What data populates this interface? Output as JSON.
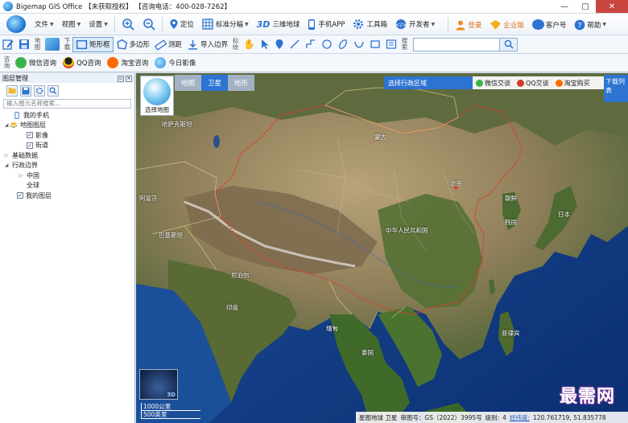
{
  "window": {
    "title": "Bigemap GIS Office 【未获取授权】 【咨询电话：400-028-7262】",
    "controls": [
      "—",
      "□",
      "✕"
    ]
  },
  "menubar": {
    "items": [
      {
        "label": "文件",
        "has_caret": true
      },
      {
        "label": "视图",
        "has_caret": true
      },
      {
        "label": "设置",
        "has_caret": true
      }
    ],
    "tools": [
      {
        "label": "定位",
        "icon": "location-icon"
      },
      {
        "label": "标准分幅",
        "icon": "grid-icon",
        "has_caret": true
      },
      {
        "label": "三维地球",
        "icon": "3d-icon",
        "prefix": "3D"
      },
      {
        "label": "手机APP",
        "icon": "phone-icon"
      },
      {
        "label": "工具箱",
        "icon": "gear-icon"
      },
      {
        "label": "开发者",
        "icon": "developer-icon",
        "has_caret": true
      }
    ],
    "right": [
      {
        "label": "登录",
        "icon": "user-icon"
      },
      {
        "label": "企业版",
        "icon": "enterprise-icon"
      },
      {
        "label": "客户号",
        "icon": "customer-icon"
      },
      {
        "label": "帮助",
        "icon": "help-icon",
        "has_caret": true
      }
    ]
  },
  "toolbar": {
    "group_map": "地图",
    "group_download": "下载",
    "rect_label": "矩形框",
    "polygon_label": "多边形",
    "measure_label": "测距",
    "import_label": "导入边界",
    "group_mark": "标绘",
    "group_search": "搜索",
    "search_placeholder": ""
  },
  "consultbar": {
    "group_label": "咨询",
    "items": [
      {
        "label": "微信咨询",
        "icon": "wechat-icon",
        "color": "#3bb34a"
      },
      {
        "label": "QQ咨询",
        "icon": "qq-icon",
        "color": "#222222"
      },
      {
        "label": "淘宝咨询",
        "icon": "taobao-icon",
        "color": "#ff6a00"
      },
      {
        "label": "今日影像",
        "icon": "globe-icon",
        "color": "#2d8ae0"
      }
    ]
  },
  "layer_panel": {
    "title": "图层管理",
    "search_placeholder": "输入图元名称搜索...",
    "tree": [
      {
        "label": "我的手机",
        "level": 1,
        "kind": "phone"
      },
      {
        "label": "地图图层",
        "level": 0,
        "kind": "folder",
        "expanded": true
      },
      {
        "label": "影像",
        "level": 2,
        "kind": "check",
        "checked": true
      },
      {
        "label": "街道",
        "level": 2,
        "kind": "check",
        "checked": true
      },
      {
        "label": "基础数据",
        "level": 0,
        "kind": "group",
        "expanded": false
      },
      {
        "label": "行政边界",
        "level": 0,
        "kind": "group",
        "expanded": true
      },
      {
        "label": "中国",
        "level": 1,
        "kind": "group",
        "expanded": false
      },
      {
        "label": "全球",
        "level": 1,
        "kind": "text"
      },
      {
        "label": "我的图层",
        "level": 0,
        "kind": "check",
        "checked": true
      }
    ]
  },
  "map": {
    "tabs": [
      {
        "label": "地图",
        "active": false
      },
      {
        "label": "卫星",
        "active": true
      },
      {
        "label": "地形",
        "active": false
      }
    ],
    "choose_map_label": "选择地图",
    "region_select": "选择行政区域",
    "region_buttons": [
      {
        "label": "微信交谈",
        "icon": "wechat-icon",
        "color": "#3bb34a"
      },
      {
        "label": "QQ交谈",
        "icon": "qq-icon",
        "color": "#d43b2a"
      },
      {
        "label": "淘宝购买",
        "icon": "taobao-icon",
        "color": "#ff6a00"
      }
    ],
    "download_list": "下载列表",
    "labels": [
      "哈萨克斯坦",
      "蒙古",
      "中华人民共和国",
      "北京",
      "印度",
      "尼泊尔",
      "泰国",
      "菲律宾",
      "朝鲜",
      "韩国",
      "日本",
      "巴基斯坦",
      "阿富汗",
      "缅甸"
    ],
    "scale_km": "1000公里",
    "scale_mi": "500英里",
    "minimap_3d": "3D",
    "status": {
      "source": "星图地球 卫星",
      "approval": "审图号：GS（2022）3995号",
      "zoom_label": "级别:",
      "zoom": "4",
      "coord_label": "经纬度:",
      "coords": "120.761719, 51.835778"
    },
    "watermark": "最需网"
  }
}
